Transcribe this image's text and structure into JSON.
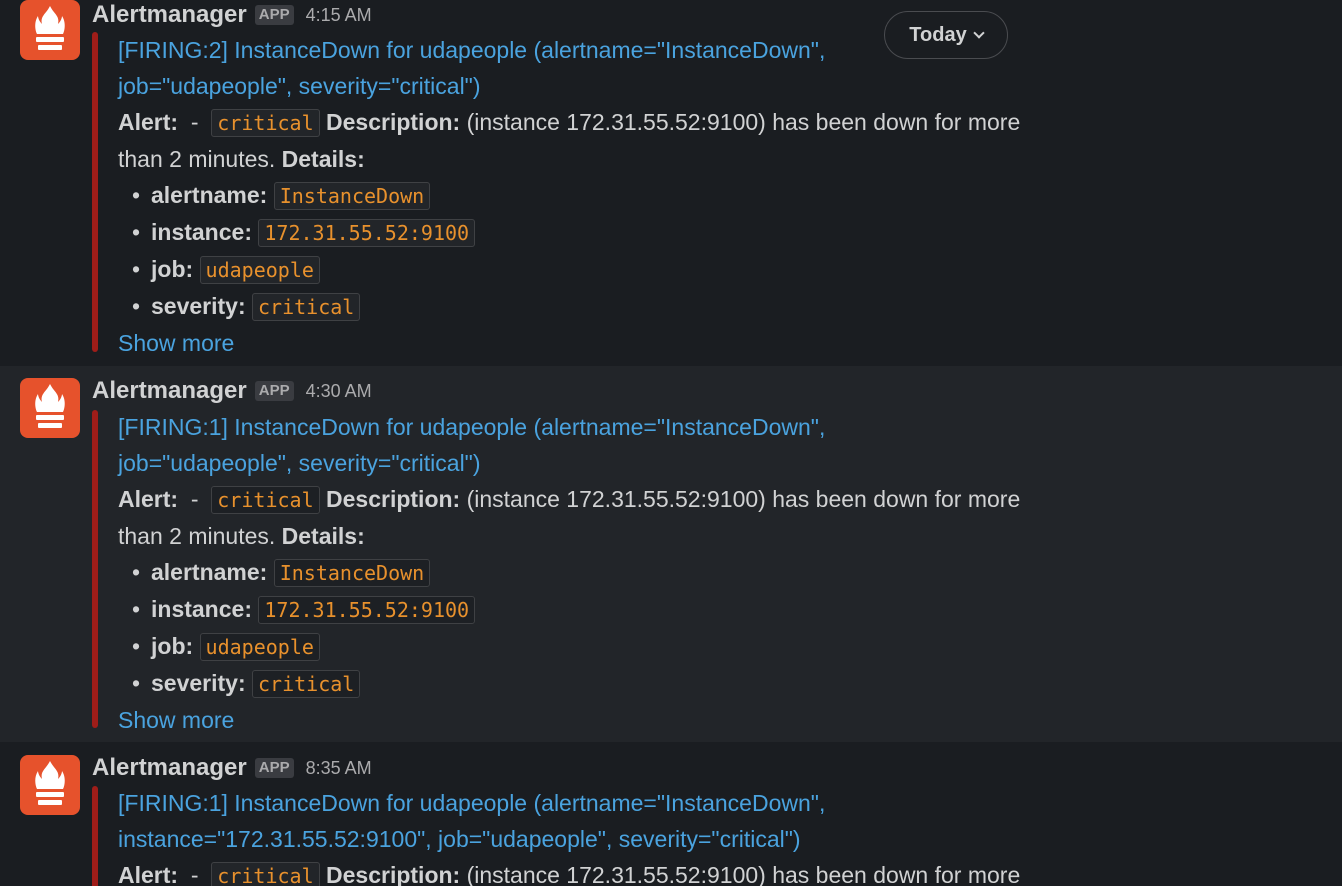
{
  "day_divider": {
    "label": "Today"
  },
  "messages": [
    {
      "sender": "Alertmanager",
      "badge": "APP",
      "time": "4:15 AM",
      "title": "[FIRING:2] InstanceDown for udapeople (alertname=\"InstanceDown\",",
      "title_line2": "job=\"udapeople\", severity=\"critical\")",
      "alert_label": "Alert:",
      "alert_sep": "-",
      "alert_severity": "critical",
      "description_label": "Description:",
      "description_text": "(instance 172.31.55.52:9100) has been down for more",
      "description_cont": "than 2 minutes.",
      "details_label": "Details:",
      "details": [
        {
          "key": "alertname:",
          "value": "InstanceDown"
        },
        {
          "key": "instance:",
          "value": "172.31.55.52:9100"
        },
        {
          "key": "job:",
          "value": "udapeople"
        },
        {
          "key": "severity:",
          "value": "critical"
        }
      ],
      "show_more": "Show more"
    },
    {
      "sender": "Alertmanager",
      "badge": "APP",
      "time": "4:30 AM",
      "title": "[FIRING:1] InstanceDown for udapeople (alertname=\"InstanceDown\",",
      "title_line2": "job=\"udapeople\", severity=\"critical\")",
      "alert_label": "Alert:",
      "alert_sep": "-",
      "alert_severity": "critical",
      "description_label": "Description:",
      "description_text": "(instance 172.31.55.52:9100) has been down for more",
      "description_cont": "than 2 minutes.",
      "details_label": "Details:",
      "details": [
        {
          "key": "alertname:",
          "value": "InstanceDown"
        },
        {
          "key": "instance:",
          "value": "172.31.55.52:9100"
        },
        {
          "key": "job:",
          "value": "udapeople"
        },
        {
          "key": "severity:",
          "value": "critical"
        }
      ],
      "show_more": "Show more"
    },
    {
      "sender": "Alertmanager",
      "badge": "APP",
      "time": "8:35 AM",
      "title": "[FIRING:1] InstanceDown for udapeople (alertname=\"InstanceDown\",",
      "title_line2": "instance=\"172.31.55.52:9100\", job=\"udapeople\", severity=\"critical\")",
      "alert_label": "Alert:",
      "alert_sep": "-",
      "alert_severity": "critical",
      "description_label": "Description:",
      "description_text": "(instance 172.31.55.52:9100) has been down for more"
    }
  ],
  "icons": {
    "avatar": "prometheus-torch-icon",
    "day_chevron": "chevron-down-icon"
  },
  "colors": {
    "attachment_bar": "#9f1d19",
    "link": "#4aa3df",
    "code": "#e8912d",
    "avatar_bg": "#e6522c"
  }
}
